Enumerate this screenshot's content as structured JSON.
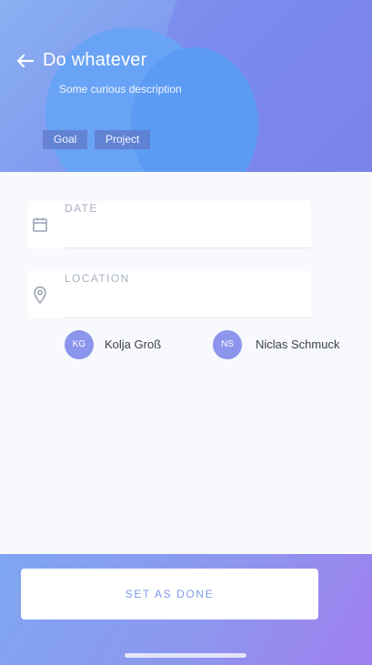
{
  "header": {
    "title": "Do whatever",
    "description": "Some curious description",
    "tags": [
      "Goal",
      "Project"
    ],
    "back_icon": "arrow-left-icon"
  },
  "form": {
    "date": {
      "label": "DATE",
      "value": "",
      "icon": "calendar-icon"
    },
    "location": {
      "label": "LOCATION",
      "value": "",
      "icon": "map-pin-icon"
    }
  },
  "people": [
    {
      "initials": "KG",
      "name": "Kolja Groß"
    },
    {
      "initials": "NS",
      "name": "Niclas Schmuck"
    }
  ],
  "footer": {
    "done_label": "SET AS DONE"
  },
  "colors": {
    "accent": "#7f9ae9",
    "avatar": "#8c95ec",
    "header_bubble": "#69a3f5"
  }
}
